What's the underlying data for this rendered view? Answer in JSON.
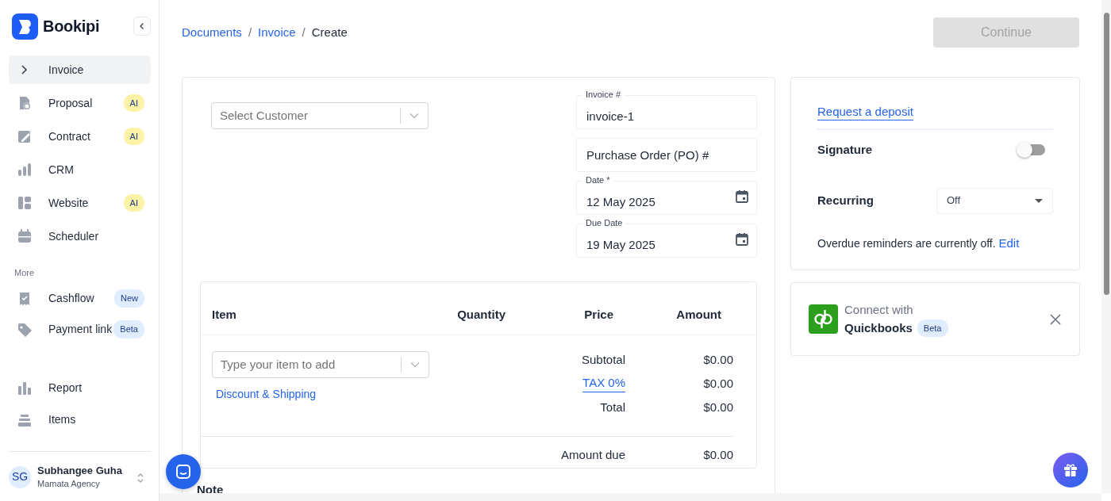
{
  "brand": {
    "name": "Bookipi"
  },
  "sidebar": {
    "items": [
      {
        "label": "Invoice",
        "selected": true
      },
      {
        "label": "Proposal",
        "selected": false,
        "badge": "AI",
        "color": "#fdf3a6"
      },
      {
        "label": "Contract",
        "selected": false,
        "badge": "AI",
        "color": "#fdf3a6"
      },
      {
        "label": "CRM",
        "selected": false
      },
      {
        "label": "Website",
        "selected": false,
        "badge": "AI",
        "color": "#fdf3a6"
      },
      {
        "label": "Scheduler",
        "selected": false
      }
    ],
    "section": "More",
    "more_items": [
      {
        "label": "Cashflow",
        "selected": false,
        "badge": "New",
        "color": "#e0edff"
      },
      {
        "label": "Payment link",
        "selected": false,
        "badge": "Beta",
        "color": "#e0edff"
      }
    ],
    "bottom_items": [
      {
        "label": "Report",
        "selected": false
      },
      {
        "label": "Items",
        "selected": false
      }
    ]
  },
  "user": {
    "initials": "SG",
    "name": "Subhangee Guha",
    "company": "Mamata Agency"
  },
  "breadcrumb_separators": [
    "/",
    "/"
  ],
  "breadcrumb": [
    {
      "label": "Documents",
      "link": true
    },
    {
      "label": "Invoice",
      "link": true
    },
    {
      "label": "Create",
      "link": false
    }
  ],
  "continue_button": {
    "label": "Continue",
    "disabled": true
  },
  "customer_select": {
    "placeholder": "Select Customer"
  },
  "fields": [
    {
      "label": "Invoice #",
      "value": "invoice-1",
      "kind": "text"
    },
    {
      "placeholder": "Purchase Order (PO) #",
      "kind": "text"
    },
    {
      "label": "Date *",
      "value": "12 May 2025",
      "kind": "date"
    },
    {
      "label": "Due Date",
      "value": "19 May 2025",
      "kind": "date"
    }
  ],
  "table": {
    "columns": [
      "Item",
      "Quantity",
      "Price",
      "Amount"
    ],
    "item_select": {
      "placeholder": "Type your item to add"
    },
    "discount_link": "Discount & Shipping",
    "totals": [
      {
        "label": "Subtotal",
        "value": "$0.00",
        "kind": "plain"
      },
      {
        "label": "TAX 0%",
        "value": "$0.00",
        "kind": "link"
      },
      {
        "label": "Total",
        "value": "$0.00",
        "kind": "plain"
      }
    ],
    "amount_due": {
      "label": "Amount due",
      "value": "$0.00"
    }
  },
  "note": {
    "title": "Note"
  },
  "options": {
    "deposit_link": "Request a deposit",
    "signature": {
      "label": "Signature",
      "on": false
    },
    "recurring": {
      "label": "Recurring",
      "value": "Off"
    },
    "reminder": {
      "text": "Overdue reminders are currently off.",
      "link": "Edit"
    }
  },
  "quickbooks": {
    "line1": "Connect with",
    "line2": "Quickbooks",
    "badge": "Beta"
  }
}
